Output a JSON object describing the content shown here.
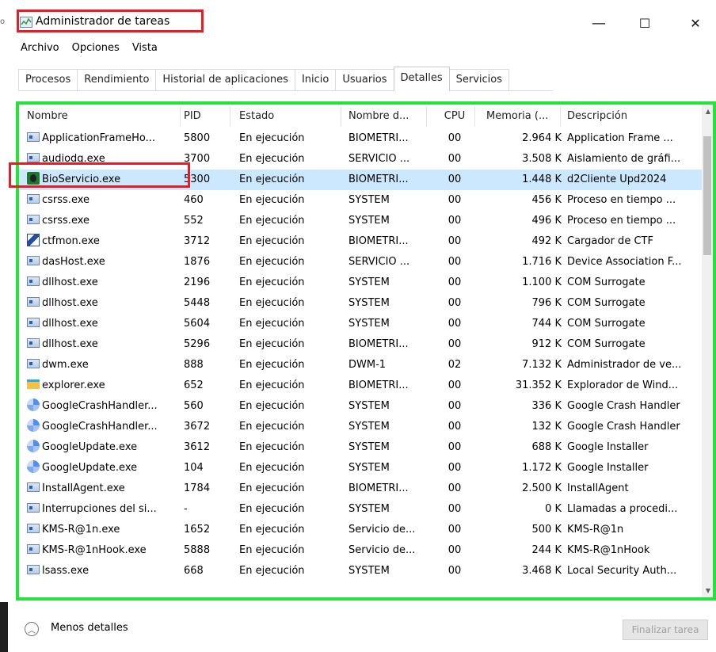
{
  "window": {
    "title": "Administrador de tareas",
    "minimize": "—",
    "maximize": "☐",
    "close": "✕"
  },
  "menu": [
    "Archivo",
    "Opciones",
    "Vista"
  ],
  "tabs": [
    "Procesos",
    "Rendimiento",
    "Historial de aplicaciones",
    "Inicio",
    "Usuarios",
    "Detalles",
    "Servicios"
  ],
  "active_tab": "Detalles",
  "columns": {
    "name": "Nombre",
    "pid": "PID",
    "status": "Estado",
    "user": "Nombre d...",
    "cpu": "CPU",
    "memory": "Memoria (...",
    "description": "Descripción"
  },
  "rows": [
    {
      "icon": "window-app-icon",
      "name": "ApplicationFrameHo...",
      "pid": "5800",
      "status": "En ejecución",
      "user": "BIOMETRI...",
      "cpu": "00",
      "memory": "2.964 K",
      "description": "Application Frame ..."
    },
    {
      "icon": "window-app-icon",
      "name": "audiodg.exe",
      "pid": "3700",
      "status": "En ejecución",
      "user": "SERVICIO ...",
      "cpu": "00",
      "memory": "3.508 K",
      "description": "Aislamiento de gráfi..."
    },
    {
      "icon": "bioservicio-icon",
      "name": "BioServicio.exe",
      "pid": "5300",
      "status": "En ejecución",
      "user": "BIOMETRI...",
      "cpu": "00",
      "memory": "1.448 K",
      "description": "d2Cliente Upd2024",
      "selected": true
    },
    {
      "icon": "window-app-icon",
      "name": "csrss.exe",
      "pid": "460",
      "status": "En ejecución",
      "user": "SYSTEM",
      "cpu": "00",
      "memory": "456 K",
      "description": "Proceso en tiempo ..."
    },
    {
      "icon": "window-app-icon",
      "name": "csrss.exe",
      "pid": "552",
      "status": "En ejecución",
      "user": "SYSTEM",
      "cpu": "00",
      "memory": "496 K",
      "description": "Proceso en tiempo ..."
    },
    {
      "icon": "pen-icon",
      "name": "ctfmon.exe",
      "pid": "3712",
      "status": "En ejecución",
      "user": "BIOMETRI...",
      "cpu": "00",
      "memory": "492 K",
      "description": "Cargador de CTF"
    },
    {
      "icon": "window-app-icon",
      "name": "dasHost.exe",
      "pid": "1876",
      "status": "En ejecución",
      "user": "SERVICIO ...",
      "cpu": "00",
      "memory": "1.716 K",
      "description": "Device Association F..."
    },
    {
      "icon": "window-app-icon",
      "name": "dllhost.exe",
      "pid": "2196",
      "status": "En ejecución",
      "user": "SYSTEM",
      "cpu": "00",
      "memory": "1.100 K",
      "description": "COM Surrogate"
    },
    {
      "icon": "window-app-icon",
      "name": "dllhost.exe",
      "pid": "5448",
      "status": "En ejecución",
      "user": "SYSTEM",
      "cpu": "00",
      "memory": "796 K",
      "description": "COM Surrogate"
    },
    {
      "icon": "window-app-icon",
      "name": "dllhost.exe",
      "pid": "5604",
      "status": "En ejecución",
      "user": "SYSTEM",
      "cpu": "00",
      "memory": "744 K",
      "description": "COM Surrogate"
    },
    {
      "icon": "window-app-icon",
      "name": "dllhost.exe",
      "pid": "5296",
      "status": "En ejecución",
      "user": "BIOMETRI...",
      "cpu": "00",
      "memory": "912 K",
      "description": "COM Surrogate"
    },
    {
      "icon": "window-app-icon",
      "name": "dwm.exe",
      "pid": "888",
      "status": "En ejecución",
      "user": "DWM-1",
      "cpu": "02",
      "memory": "7.132 K",
      "description": "Administrador de ve..."
    },
    {
      "icon": "folder-icon",
      "name": "explorer.exe",
      "pid": "652",
      "status": "En ejecución",
      "user": "BIOMETRI...",
      "cpu": "00",
      "memory": "31.352 K",
      "description": "Explorador de Wind..."
    },
    {
      "icon": "google-icon",
      "name": "GoogleCrashHandler...",
      "pid": "560",
      "status": "En ejecución",
      "user": "SYSTEM",
      "cpu": "00",
      "memory": "336 K",
      "description": "Google Crash Handler"
    },
    {
      "icon": "google-icon",
      "name": "GoogleCrashHandler...",
      "pid": "3672",
      "status": "En ejecución",
      "user": "SYSTEM",
      "cpu": "00",
      "memory": "132 K",
      "description": "Google Crash Handler"
    },
    {
      "icon": "google-icon",
      "name": "GoogleUpdate.exe",
      "pid": "3612",
      "status": "En ejecución",
      "user": "SYSTEM",
      "cpu": "00",
      "memory": "688 K",
      "description": "Google Installer"
    },
    {
      "icon": "google-icon",
      "name": "GoogleUpdate.exe",
      "pid": "104",
      "status": "En ejecución",
      "user": "SYSTEM",
      "cpu": "00",
      "memory": "1.172 K",
      "description": "Google Installer"
    },
    {
      "icon": "window-app-icon",
      "name": "InstallAgent.exe",
      "pid": "1784",
      "status": "En ejecución",
      "user": "BIOMETRI...",
      "cpu": "00",
      "memory": "2.500 K",
      "description": "InstallAgent"
    },
    {
      "icon": "window-app-icon",
      "name": "Interrupciones del si...",
      "pid": "-",
      "status": "En ejecución",
      "user": "SYSTEM",
      "cpu": "00",
      "memory": "0 K",
      "description": "Llamadas a procedi..."
    },
    {
      "icon": "window-app-icon",
      "name": "KMS-R@1n.exe",
      "pid": "1652",
      "status": "En ejecución",
      "user": "Servicio de...",
      "cpu": "00",
      "memory": "500 K",
      "description": "KMS-R@1n"
    },
    {
      "icon": "window-app-icon",
      "name": "KMS-R@1nHook.exe",
      "pid": "5888",
      "status": "En ejecución",
      "user": "Servicio de...",
      "cpu": "00",
      "memory": "244 K",
      "description": "KMS-R@1nHook"
    },
    {
      "icon": "window-app-icon",
      "name": "lsass.exe",
      "pid": "668",
      "status": "En ejecución",
      "user": "SYSTEM",
      "cpu": "00",
      "memory": "3.468 K",
      "description": "Local Security Auth..."
    }
  ],
  "footer": {
    "less_details": "Menos detalles",
    "end_task": "Finalizar tarea"
  },
  "colors": {
    "highlight_red": "#e81c24",
    "highlight_green": "#27e23a",
    "selected_row": "#cce8ff"
  }
}
